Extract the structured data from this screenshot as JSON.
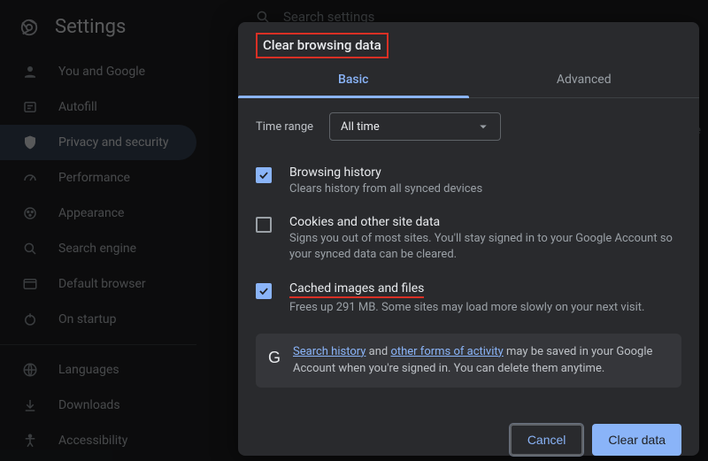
{
  "header": {
    "title": "Settings"
  },
  "sidebar": {
    "items": [
      {
        "label": "You and Google",
        "icon": "person"
      },
      {
        "label": "Autofill",
        "icon": "autofill"
      },
      {
        "label": "Privacy and security",
        "icon": "shield",
        "active": true
      },
      {
        "label": "Performance",
        "icon": "performance"
      },
      {
        "label": "Appearance",
        "icon": "appearance"
      },
      {
        "label": "Search engine",
        "icon": "search"
      },
      {
        "label": "Default browser",
        "icon": "browser"
      },
      {
        "label": "On startup",
        "icon": "startup"
      }
    ],
    "footer_items": [
      {
        "label": "Languages",
        "icon": "languages"
      },
      {
        "label": "Downloads",
        "icon": "downloads"
      },
      {
        "label": "Accessibility",
        "icon": "accessibility"
      }
    ]
  },
  "search": {
    "placeholder": "Search settings"
  },
  "bg_hint": "re",
  "dialog": {
    "title": "Clear browsing data",
    "tabs": {
      "basic": "Basic",
      "advanced": "Advanced"
    },
    "time_range": {
      "label": "Time range",
      "value": "All time"
    },
    "options": [
      {
        "checked": true,
        "title": "Browsing history",
        "desc": "Clears history from all synced devices"
      },
      {
        "checked": false,
        "title": "Cookies and other site data",
        "desc": "Signs you out of most sites. You'll stay signed in to your Google Account so your synced data can be cleared."
      },
      {
        "checked": true,
        "title": "Cached images and files",
        "desc": "Frees up 291 MB. Some sites may load more slowly on your next visit."
      }
    ],
    "info": {
      "link1": "Search history",
      "mid1": " and ",
      "link2": "other forms of activity",
      "tail": " may be saved in your Google Account when you're signed in. You can delete them anytime."
    },
    "actions": {
      "cancel": "Cancel",
      "clear": "Clear data"
    }
  }
}
